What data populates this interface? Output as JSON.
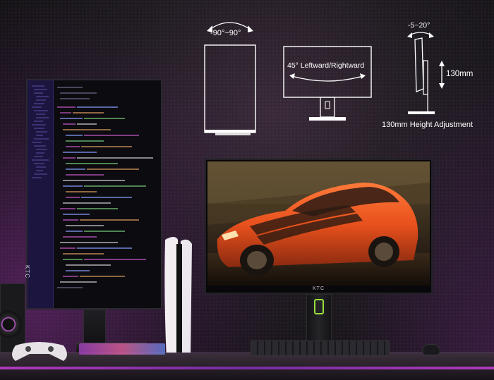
{
  "labels": {
    "swivel": "-90°~90°",
    "pivot": "45° Leftward/Rightward",
    "tilt": "-5~20°",
    "height_value": "130mm",
    "height_caption": "130mm Height Adjustment"
  },
  "branding": {
    "logo": "KTC"
  },
  "colors": {
    "accent_purple": "#c040d8",
    "stand_ring_green": "#9ae03a",
    "car_orange": "#e8501c"
  },
  "icons": {
    "swivel": "curved-double-arrow-icon",
    "pivot": "curved-double-arrow-icon",
    "tilt": "curved-double-arrow-icon",
    "height": "vertical-double-arrow-icon"
  }
}
